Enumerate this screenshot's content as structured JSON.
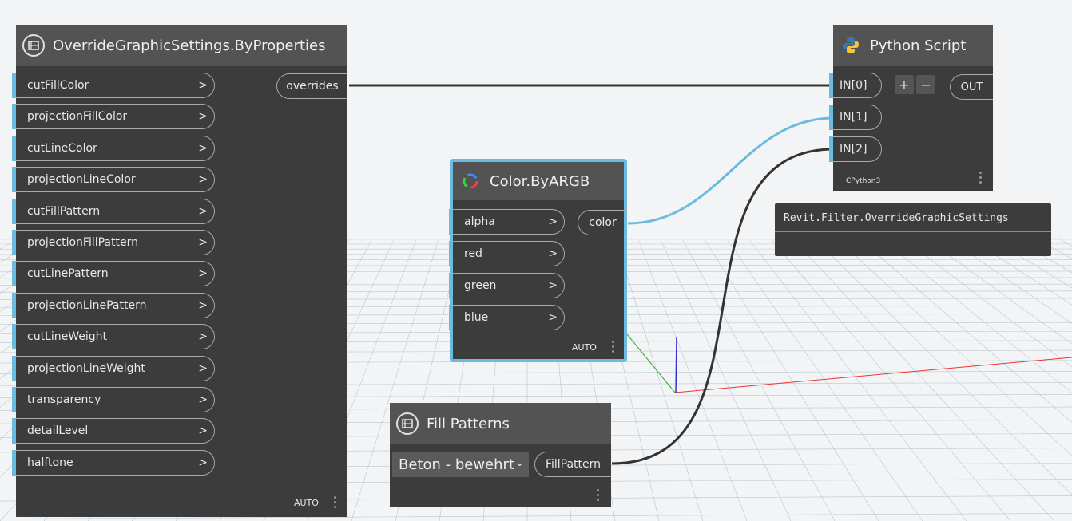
{
  "nodes": {
    "override": {
      "title": "OverrideGraphicSettings.ByProperties",
      "inputs": [
        "cutFillColor",
        "projectionFillColor",
        "cutLineColor",
        "projectionLineColor",
        "cutFillPattern",
        "projectionFillPattern",
        "cutLinePattern",
        "projectionLinePattern",
        "cutLineWeight",
        "projectionLineWeight",
        "transparency",
        "detailLevel",
        "halftone"
      ],
      "output": "overrides",
      "lacing": "AUTO"
    },
    "color": {
      "title": "Color.ByARGB",
      "inputs": [
        "alpha",
        "red",
        "green",
        "blue"
      ],
      "output": "color",
      "lacing": "AUTO"
    },
    "python": {
      "title": "Python Script",
      "inputs": [
        "IN[0]",
        "IN[1]",
        "IN[2]"
      ],
      "add_label": "+",
      "remove_label": "−",
      "output": "OUT",
      "engine": "CPython3",
      "preview": "Revit.Filter.OverrideGraphicSettings"
    },
    "fill": {
      "title": "Fill Patterns",
      "dropdown_value": "Beton - bewehrt",
      "output": "FillPattern"
    }
  },
  "icons": {
    "override": "revit-node-icon",
    "color": "color-palette-icon",
    "python": "python-icon",
    "fill": "revit-node-icon"
  },
  "colors": {
    "node_body": "#3c3c3c",
    "node_header": "#535353",
    "port_accent": "#6bbbe0",
    "selection": "#6bbbe0",
    "wire": "#333333",
    "wire_selected": "#6bbbe0"
  }
}
